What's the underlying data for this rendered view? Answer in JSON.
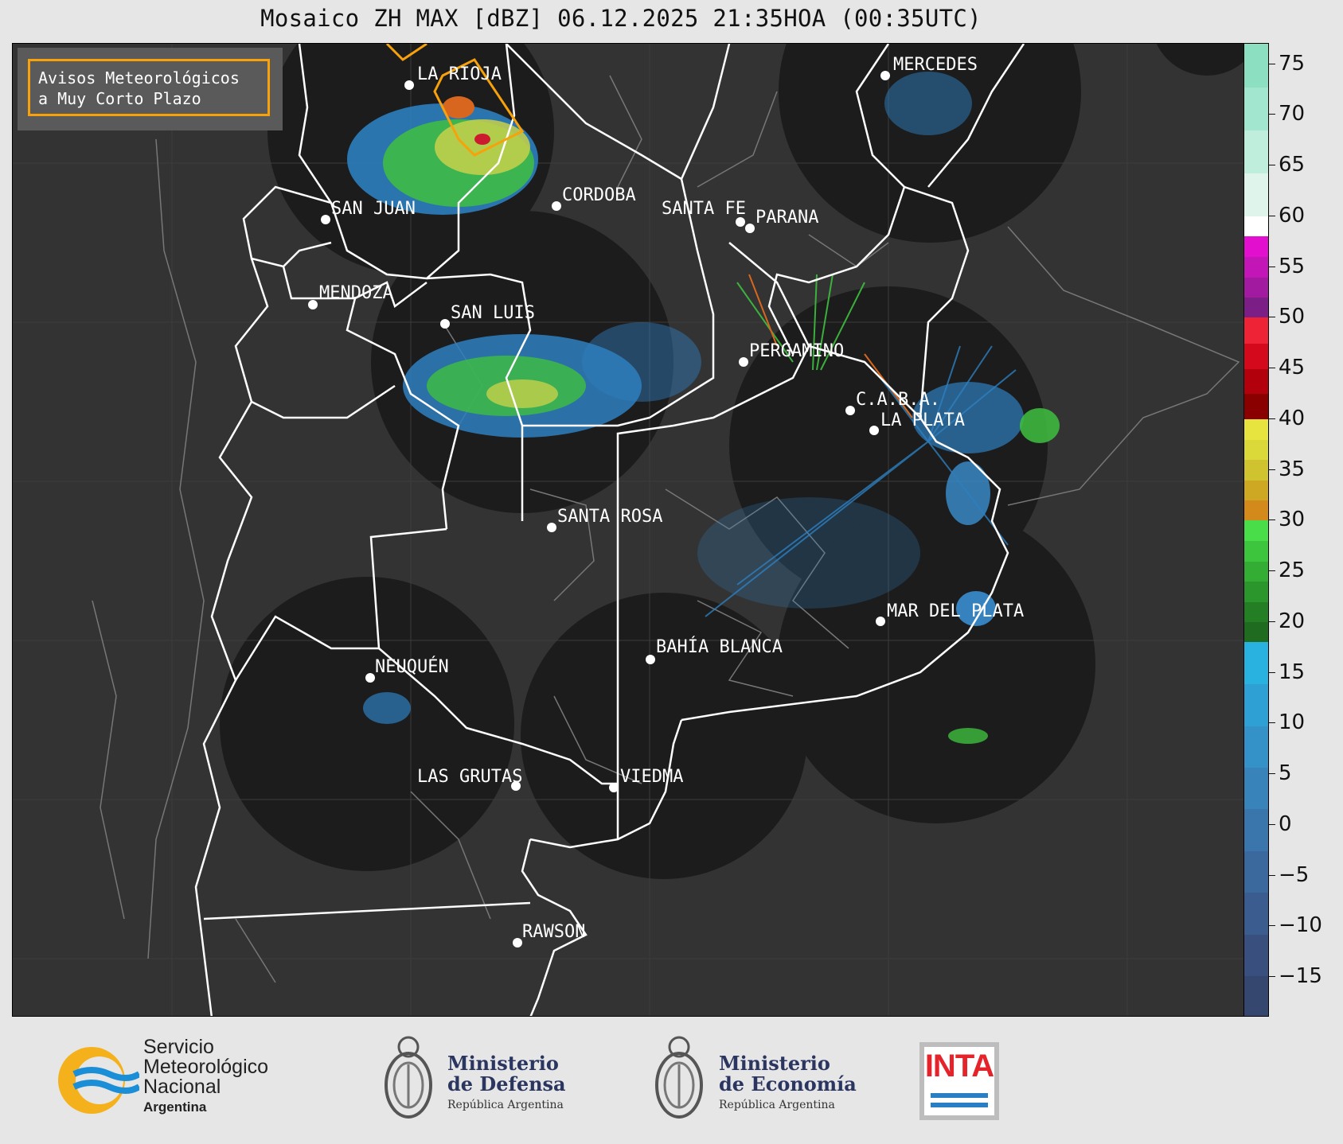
{
  "title": "Mosaico ZH MAX [dBZ] 06.12.2025 21:35HOA (00:35UTC)",
  "alert_box": {
    "line1": "Avisos Meteorológicos",
    "line2": "a Muy Corto Plazo",
    "border_color": "#f7a10b"
  },
  "cities": [
    {
      "name": "LA RIOJA",
      "lon_lat_hint": "la-rioja"
    },
    {
      "name": "MERCEDES",
      "lon_lat_hint": "mercedes"
    },
    {
      "name": "CORDOBA",
      "lon_lat_hint": "cordoba"
    },
    {
      "name": "SAN JUAN",
      "lon_lat_hint": "san-juan"
    },
    {
      "name": "SANTA FE",
      "lon_lat_hint": "santa-fe"
    },
    {
      "name": "PARANA",
      "lon_lat_hint": "parana"
    },
    {
      "name": "MENDOZA",
      "lon_lat_hint": "mendoza"
    },
    {
      "name": "SAN LUIS",
      "lon_lat_hint": "san-luis"
    },
    {
      "name": "PERGAMINO",
      "lon_lat_hint": "pergamino"
    },
    {
      "name": "C.A.B.A.",
      "lon_lat_hint": "caba"
    },
    {
      "name": "LA PLATA",
      "lon_lat_hint": "la-plata"
    },
    {
      "name": "SANTA ROSA",
      "lon_lat_hint": "santa-rosa"
    },
    {
      "name": "MAR DEL PLATA",
      "lon_lat_hint": "mar-del-plata"
    },
    {
      "name": "BAHÍA BLANCA",
      "lon_lat_hint": "bahia-blanca"
    },
    {
      "name": "NEUQUÉN",
      "lon_lat_hint": "neuquen"
    },
    {
      "name": "LAS GRUTAS",
      "lon_lat_hint": "las-grutas"
    },
    {
      "name": "VIEDMA",
      "lon_lat_hint": "viedma"
    },
    {
      "name": "RAWSON",
      "lon_lat_hint": "rawson"
    }
  ],
  "colorbar": {
    "unit": "dBZ",
    "ticks": [
      "75",
      "70",
      "65",
      "60",
      "55",
      "50",
      "45",
      "40",
      "35",
      "30",
      "25",
      "20",
      "15",
      "10",
      "5",
      "0",
      "−5",
      "−10",
      "−15"
    ],
    "range": [
      -19,
      77
    ]
  },
  "logos": {
    "smn": {
      "line1": "Servicio",
      "line2": "Meteorológico",
      "line3": "Nacional",
      "line4": "Argentina"
    },
    "defensa": {
      "line1": "Ministerio",
      "line2": "de Defensa",
      "line3": "República Argentina"
    },
    "economia": {
      "line1": "Ministerio",
      "line2": "de Economía",
      "line3": "República Argentina"
    },
    "inta": {
      "word": "INTA"
    }
  },
  "colors": {
    "map_background": "#333333",
    "radar_coverage": "#1c1c1c",
    "boundary": "#ffffff",
    "dept_lines": "#7a7a7a"
  }
}
